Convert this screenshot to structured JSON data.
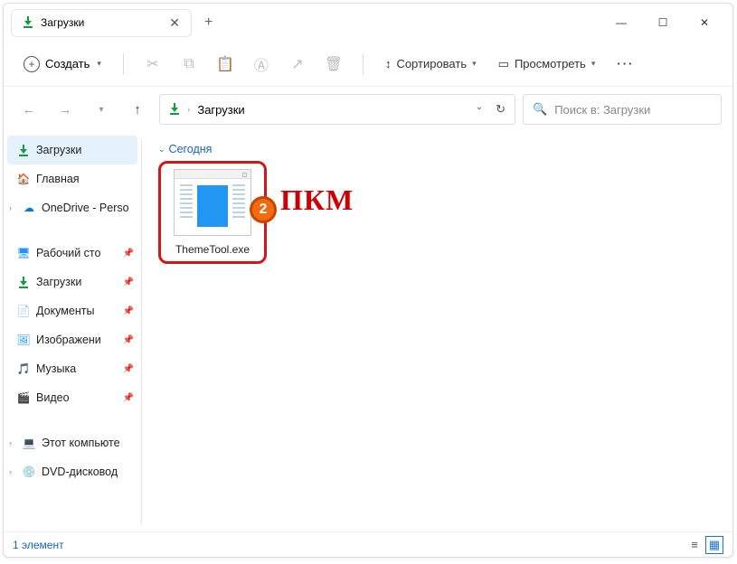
{
  "tab": {
    "title": "Загрузки"
  },
  "toolbar": {
    "create": "Создать",
    "sort": "Сортировать",
    "view": "Просмотреть"
  },
  "breadcrumb": {
    "location": "Загрузки"
  },
  "search": {
    "placeholder": "Поиск в: Загрузки"
  },
  "sidebar": {
    "downloads": "Загрузки",
    "home": "Главная",
    "onedrive": "OneDrive - Perso",
    "desktop": "Рабочий сто",
    "downloads2": "Загрузки",
    "documents": "Документы",
    "pictures": "Изображени",
    "music": "Музыка",
    "videos": "Видео",
    "thispc": "Этот компьюте",
    "dvd": "DVD-дисковод"
  },
  "content": {
    "group": "Сегодня",
    "file": "ThemeTool.exe"
  },
  "annotation": {
    "badge": "2",
    "label": "ПКМ"
  },
  "status": {
    "count": "1 элемент"
  }
}
